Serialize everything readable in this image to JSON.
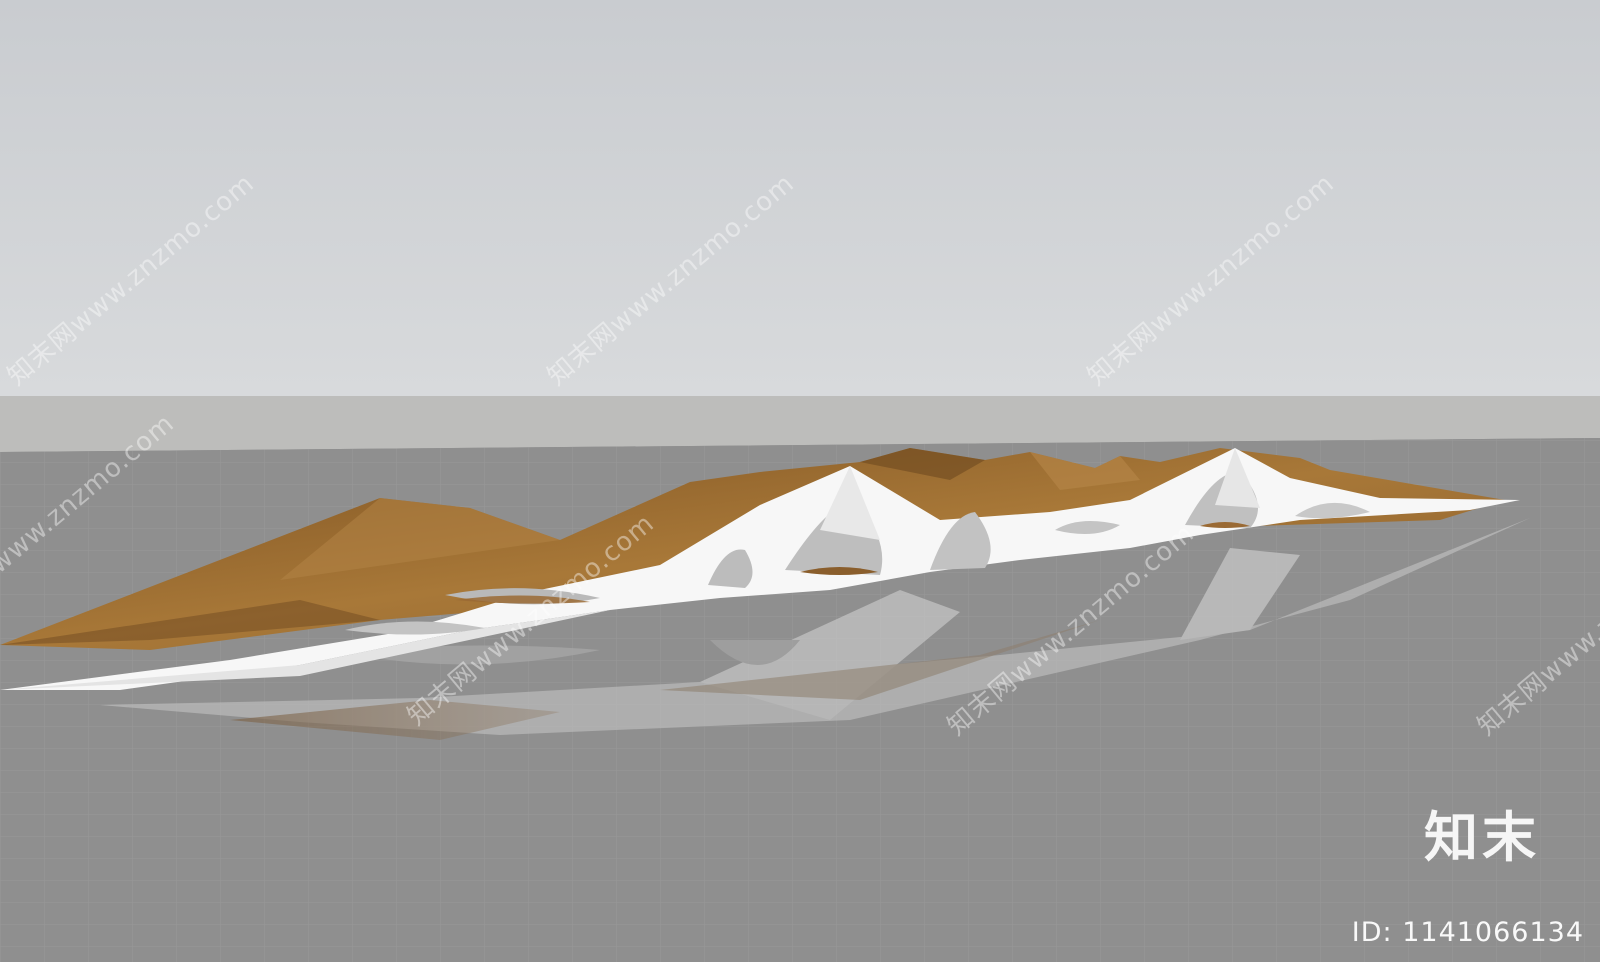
{
  "watermark": {
    "text": "知末网www.znzmo.com"
  },
  "brand": {
    "name": "知末",
    "id_label": "ID: 1141066134"
  },
  "colors": {
    "sky": "#cfd2d6",
    "horizon": "#bcbcba",
    "ground": "#8f8f8f",
    "grid": "#a3a3a3",
    "wood": "#9a6a34",
    "canopy": "#ffffff"
  }
}
